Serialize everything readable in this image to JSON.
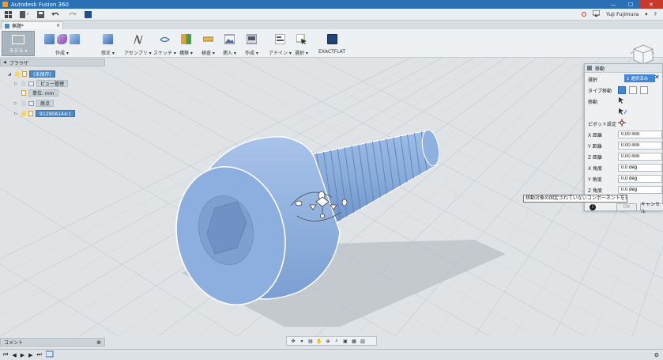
{
  "titlebar": {
    "title": "Autodesk Fusion 360",
    "minimize": "—",
    "maximize": "☐",
    "close": "✕"
  },
  "qab": {
    "user": "Yuji Fujimura",
    "user_caret": "▾",
    "help": "?"
  },
  "document_tab": {
    "name": "無題*",
    "close": "×"
  },
  "ribbon": {
    "workspace": "モデル ▾",
    "groups": [
      {
        "label": "作成 ▾"
      },
      {
        "label": "修正 ▾"
      },
      {
        "label": "アセンブリ ▾"
      },
      {
        "label": "スケッチ ▾"
      },
      {
        "label": "構築 ▾"
      },
      {
        "label": "検査 ▾"
      },
      {
        "label": "挿入 ▾"
      },
      {
        "label": "作成 ▾"
      },
      {
        "label": "アドイン ▾"
      },
      {
        "label": "選択 ▾"
      },
      {
        "label": "EXACTFLAT"
      }
    ]
  },
  "browser": {
    "header": "ブラウザ",
    "caret": "◀",
    "root": "(未保存)",
    "items": [
      "ビュー管理",
      "単位: mm",
      "原点",
      "91290A144:1"
    ]
  },
  "move_panel": {
    "title": "移動",
    "selection_label": "選択",
    "selection_value": "1 選択済み",
    "close": "✕",
    "type_label": "タイプ移動",
    "move_label": "移動",
    "pivot_label": "ピボット設定",
    "fields": [
      {
        "label": "X 距離",
        "value": "0.00 mm"
      },
      {
        "label": "Y 距離",
        "value": "0.00 mm"
      },
      {
        "label": "Z 距離",
        "value": "0.00 mm"
      },
      {
        "label": "X 角度",
        "value": "0.0 deg"
      },
      {
        "label": "Y 角度",
        "value": "0.0 deg"
      },
      {
        "label": "Z 角度",
        "value": "0.0 deg"
      }
    ],
    "info": "i",
    "ok": "OK",
    "cancel": "キャンセル"
  },
  "tooltip": "移動対象の固定されていないコンポーネントを選択",
  "comments": {
    "label": "コメント",
    "add": "⊕"
  },
  "timeline": {
    "first": "⏮",
    "prev": "◀",
    "play": "▶",
    "next": "▶",
    "last": "⏭",
    "settings": "⚙"
  },
  "colors": {
    "titlebar": "#2b6fb5",
    "selection": "#3f86d6",
    "part": "#8fb1e0"
  }
}
